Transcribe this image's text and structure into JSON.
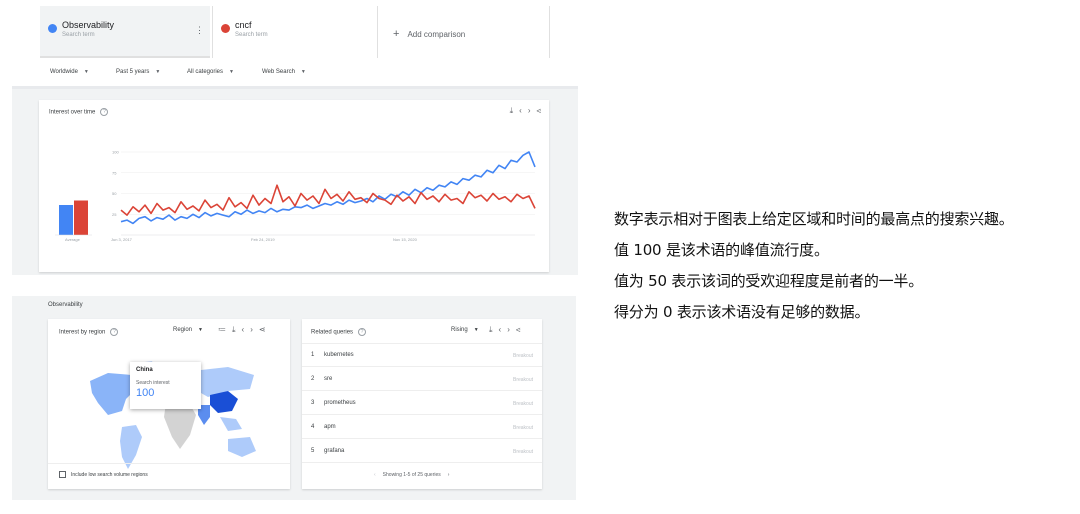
{
  "terms": [
    {
      "name": "Observability",
      "sub": "Search term",
      "color": "#4285f4"
    },
    {
      "name": "cncf",
      "sub": "Search term",
      "color": "#db4437"
    }
  ],
  "add_comparison": "Add comparison",
  "filters": [
    "Worldwide",
    "Past 5 years",
    "All categories",
    "Web Search"
  ],
  "interest_over_time": {
    "title": "Interest over time",
    "average_label": "Average",
    "x_ticks": [
      "Jun 3, 2017",
      "Feb 24, 2019",
      "Nov 15, 2020"
    ],
    "y_ticks": [
      "100",
      "75",
      "50",
      "25"
    ]
  },
  "chart_data": {
    "type": "line",
    "title": "Interest over time",
    "ylim": [
      0,
      100
    ],
    "grid": true,
    "categories": [
      "Jun 3, 2017",
      "Feb 24, 2019",
      "Nov 15, 2020"
    ],
    "series": [
      {
        "name": "Observability",
        "color": "#4285f4",
        "values": [
          16,
          18,
          14,
          20,
          22,
          17,
          21,
          19,
          24,
          18,
          22,
          20,
          25,
          21,
          27,
          23,
          26,
          24,
          22,
          28,
          25,
          30,
          26,
          29,
          27,
          32,
          28,
          31,
          30,
          34,
          33,
          36,
          32,
          35,
          38,
          36,
          40,
          37,
          42,
          39,
          41,
          44,
          40,
          47,
          43,
          49,
          46,
          52,
          48,
          55,
          51,
          57,
          54,
          60,
          58,
          64,
          61,
          68,
          66,
          72,
          70,
          78,
          75,
          84,
          80,
          90,
          88,
          96,
          100,
          82
        ]
      },
      {
        "name": "cncf",
        "color": "#db4437",
        "values": [
          30,
          24,
          34,
          28,
          36,
          26,
          38,
          30,
          33,
          27,
          40,
          31,
          35,
          29,
          42,
          33,
          37,
          30,
          45,
          34,
          39,
          32,
          48,
          36,
          44,
          38,
          60,
          40,
          46,
          35,
          50,
          42,
          47,
          38,
          55,
          44,
          49,
          41,
          52,
          43,
          45,
          39,
          50,
          44,
          42,
          37,
          48,
          41,
          46,
          38,
          51,
          43,
          47,
          40,
          49,
          42,
          44,
          38,
          52,
          45,
          48,
          41,
          50,
          43,
          46,
          40,
          49,
          44,
          47,
          32
        ]
      }
    ],
    "averages": [
      {
        "name": "Observability",
        "value": 40
      },
      {
        "name": "cncf",
        "value": 46
      }
    ]
  },
  "section_label": "Observability",
  "interest_by_region": {
    "title": "Interest by region",
    "dropdown": "Region",
    "tooltip_country": "China",
    "tooltip_label": "Search interest",
    "tooltip_value": "100",
    "checkbox_label": "Include low search volume regions"
  },
  "related_queries": {
    "title": "Related queries",
    "dropdown": "Rising",
    "items": [
      {
        "num": "1",
        "query": "kubernetes",
        "badge": "Breakout"
      },
      {
        "num": "2",
        "query": "sre",
        "badge": "Breakout"
      },
      {
        "num": "3",
        "query": "prometheus",
        "badge": "Breakout"
      },
      {
        "num": "4",
        "query": "apm",
        "badge": "Breakout"
      },
      {
        "num": "5",
        "query": "grafana",
        "badge": "Breakout"
      }
    ],
    "pagination": "Showing 1-5 of 25 queries"
  },
  "explanation": [
    "数字表示相对于图表上给定区域和时间的最高点的搜索兴趣。",
    "值 100 是该术语的峰值流行度。",
    "值为 50 表示该词的受欢迎程度是前者的一半。",
    "得分为 0 表示该术语没有足够的数据。"
  ]
}
